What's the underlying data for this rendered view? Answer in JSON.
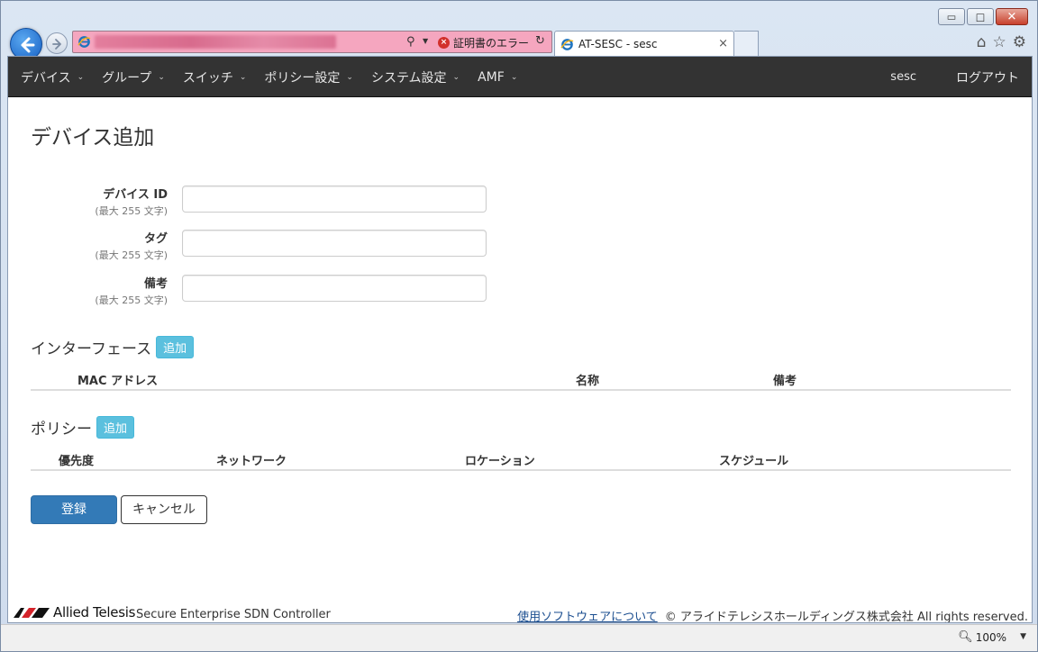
{
  "browser": {
    "window_controls": {
      "minimize": "▭",
      "maximize": "□",
      "close": "✕"
    },
    "address": {
      "cert_error": "証明書のエラー"
    },
    "tab": {
      "title": "AT-SESC - sesc",
      "close": "×"
    },
    "zoom": "100%"
  },
  "navbar": {
    "items": [
      {
        "label": "デバイス"
      },
      {
        "label": "グループ"
      },
      {
        "label": "スイッチ"
      },
      {
        "label": "ポリシー設定"
      },
      {
        "label": "システム設定"
      },
      {
        "label": "AMF"
      }
    ],
    "user": "sesc",
    "logout": "ログアウト"
  },
  "page": {
    "title": "デバイス追加",
    "fields": [
      {
        "label": "デバイス ID",
        "hint": "(最大 255 文字)",
        "value": ""
      },
      {
        "label": "タグ",
        "hint": "(最大 255 文字)",
        "value": ""
      },
      {
        "label": "備考",
        "hint": "(最大 255 文字)",
        "value": ""
      }
    ],
    "interfaces": {
      "title": "インターフェース",
      "add_label": "追加",
      "columns": [
        "MAC アドレス",
        "名称",
        "備考"
      ]
    },
    "policies": {
      "title": "ポリシー",
      "add_label": "追加",
      "columns": [
        "優先度",
        "ネットワーク",
        "ロケーション",
        "スケジュール"
      ]
    },
    "submit_label": "登録",
    "cancel_label": "キャンセル"
  },
  "footer": {
    "brand": "Allied Telesis",
    "product": "Secure Enterprise SDN Controller",
    "about_link": "使用ソフトウェアについて",
    "copyright": "© アライドテレシスホールディングス株式会社 All rights reserved."
  },
  "colors": {
    "navbar_bg": "#333333",
    "primary": "#337ab7",
    "info": "#5bc0de",
    "address_error": "#f5a6bf"
  }
}
